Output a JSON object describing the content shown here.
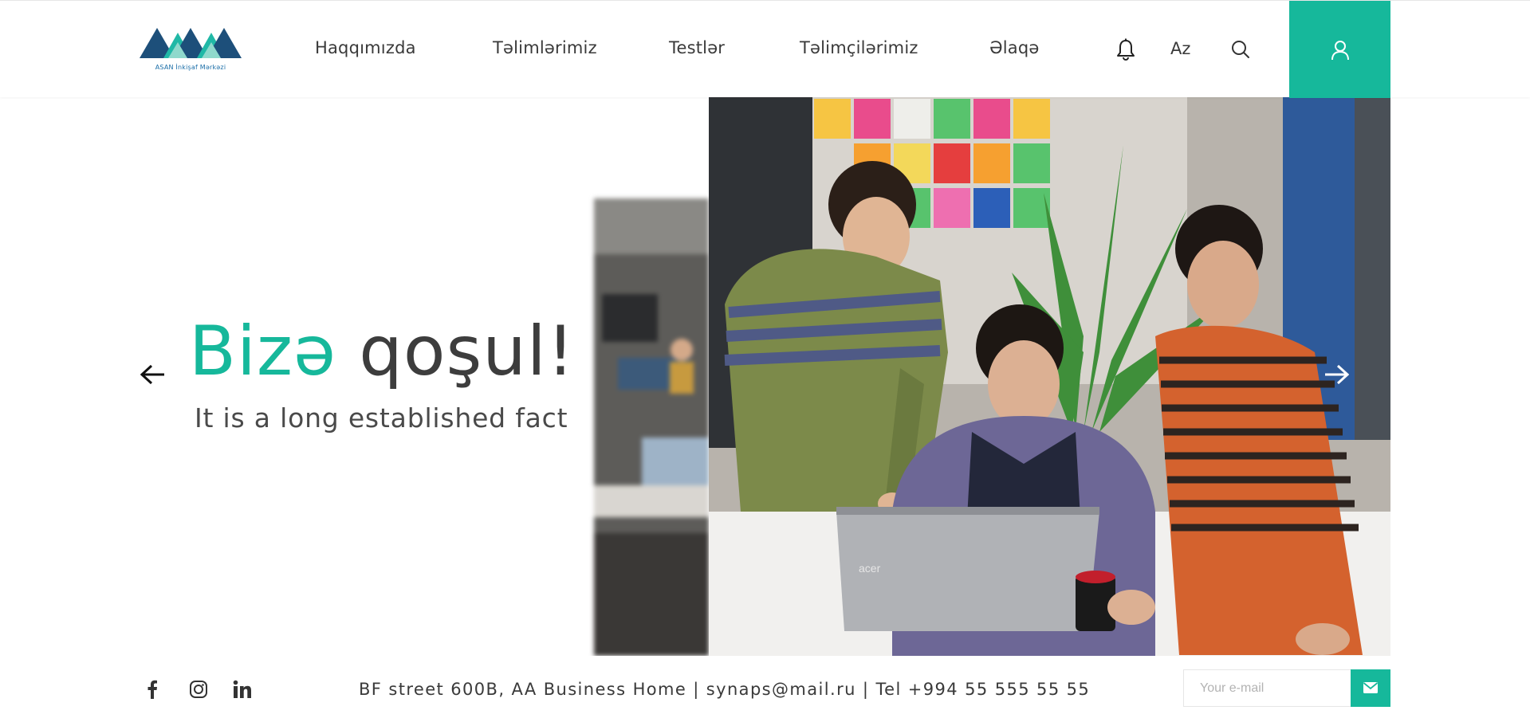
{
  "brand": {
    "logo_text": "ASAN İnkişaf Mərkəzi",
    "accent_color": "#16b89b",
    "logo_dark": "#1d4f7a",
    "logo_light": "#20b8a6"
  },
  "nav": {
    "items": [
      {
        "label": "Haqqımızda"
      },
      {
        "label": "Təlimlərimiz"
      },
      {
        "label": "Testlər"
      },
      {
        "label": "Təlimçilərimiz"
      },
      {
        "label": "Əlaqə"
      }
    ],
    "language": "Az",
    "icons": [
      "bell-icon",
      "search-icon",
      "user-icon"
    ]
  },
  "hero": {
    "title_accent": "Bizə",
    "title_rest": "qoşul!",
    "subtitle": "It is a long established fact"
  },
  "footer": {
    "social": [
      "facebook-icon",
      "instagram-icon",
      "linkedin-icon"
    ],
    "address": "BF street 600B, AA Business Home |  synaps@mail.ru  | Tel +994 55 555 55 55",
    "email_placeholder": "Your e-mail"
  }
}
